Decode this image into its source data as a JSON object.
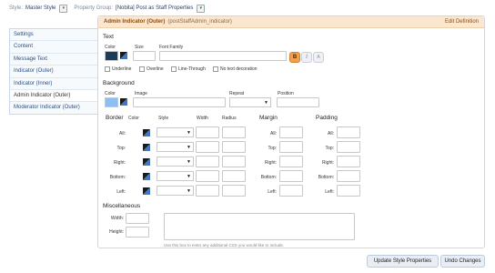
{
  "topbar": {
    "style_label": "Style:",
    "style_value": "Master Style",
    "group_label": "Property Group:",
    "group_value": "[Nobita] Post as Staff Properties"
  },
  "sidebar": {
    "items": [
      {
        "label": "Settings"
      },
      {
        "label": "Content"
      },
      {
        "label": "Message Text"
      },
      {
        "label": "Indicator (Outer)"
      },
      {
        "label": "Indicator (Inner)"
      },
      {
        "label": "Admin Indicator (Outer)"
      },
      {
        "label": "Moderator Indicator (Outer)"
      }
    ]
  },
  "panel": {
    "title": "Admin Indicator (Outer)",
    "subtitle": "(postStaffAdmin_indicator)",
    "edit_link": "Edit Definition"
  },
  "text": {
    "heading": "Text",
    "color_label": "Color",
    "size_label": "Size",
    "font_family_label": "Font Family",
    "bold": "B",
    "italic": "I",
    "small_caps": "A",
    "underline": "Underline",
    "overline": "Overline",
    "line_through": "Line-Through",
    "no_decoration": "No text decoration",
    "swatch_color": "#1c3c5a"
  },
  "background": {
    "heading": "Background",
    "color_label": "Color",
    "image_label": "Image",
    "repeat_label": "Repeat",
    "position_label": "Position",
    "swatch_color": "#8fbef0"
  },
  "border": {
    "heading": "Border",
    "color_label": "Color",
    "style_label": "Style",
    "width_label": "Width",
    "radius_label": "Radius",
    "sides": [
      "All:",
      "Top:",
      "Right:",
      "Bottom:",
      "Left:"
    ]
  },
  "margin": {
    "heading": "Margin",
    "sides": [
      "All:",
      "Top:",
      "Right:",
      "Bottom:",
      "Left:"
    ]
  },
  "padding": {
    "heading": "Padding",
    "sides": [
      "All:",
      "Top:",
      "Right:",
      "Bottom:",
      "Left:"
    ]
  },
  "misc": {
    "heading": "Miscellaneous",
    "width_label": "Width:",
    "height_label": "Height:",
    "hint": "Use this box to enter any additional CSS you would like to include."
  },
  "buttons": {
    "update": "Update Style Properties",
    "undo": "Undo Changes"
  },
  "colors": {
    "header_bg": "#fbe7cf",
    "header_text": "#8a4d10",
    "link": "#2c4f84",
    "bold_button": "#f0a050"
  }
}
